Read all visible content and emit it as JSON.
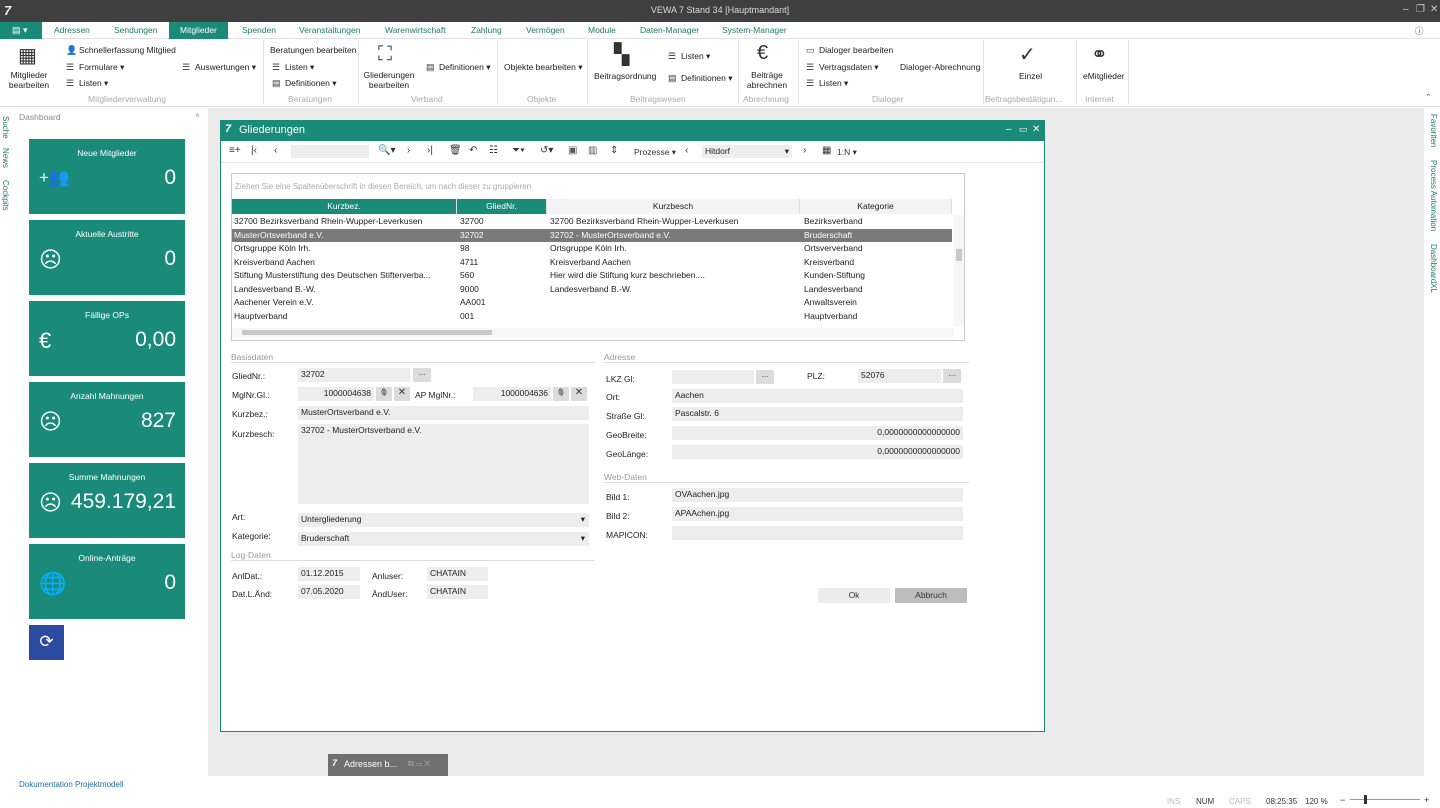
{
  "window": {
    "title": "VEWA 7 Stand 34 [Hauptmandant]",
    "logo": "7"
  },
  "menu": {
    "tabs": [
      "Adressen",
      "Sendungen",
      "Mitglieder",
      "Spenden",
      "Veranstaltungen",
      "Warenwirtschaft",
      "Zahlung",
      "Vermögen",
      "Module",
      "Daten-Manager",
      "System-Manager"
    ],
    "active": "Mitglieder"
  },
  "ribbon": {
    "mitglieder_bearbeiten": "Mitglieder bearbeiten",
    "schnellerfassung": "Schnellerfassung Mitglied",
    "formulare": "Formulare",
    "listen": "Listen",
    "auswertungen": "Auswertungen",
    "beratungen_bearbeiten": "Beratungen bearbeiten",
    "beratungen_listen": "Listen",
    "beratungen_definitionen": "Definitionen",
    "gliederungen_bearbeiten": "Gliederungen bearbeiten",
    "verband_definitionen": "Definitionen",
    "objekte_bearbeiten": "Objekte bearbeiten",
    "beitragsordnung": "Beitragsordnung",
    "bw_listen": "Listen",
    "bw_definitionen": "Definitionen",
    "beitraege_abrechnen": "Beiträge abrechnen",
    "dialoger_bearbeiten": "Dialoger bearbeiten",
    "vertragsdaten": "Vertragsdaten",
    "dialoger_listen": "Listen",
    "dialoger_abrechnung": "Dialoger-Abrechnung",
    "einzel": "Einzel",
    "emitglieder": "eMitglieder",
    "groups": [
      "Mitgliederverwaltung",
      "Beratungen",
      "Verband",
      "Objekte",
      "Beitragswesen",
      "Abrechnung",
      "Dialoger",
      "Beitragsbestätigun...",
      "Internet"
    ]
  },
  "sidenav": [
    "Suche",
    "News",
    "Cockpits"
  ],
  "rightnav": [
    "Favoriten",
    "Process Automation",
    "DashboardXL"
  ],
  "dashboard": {
    "title": "Dashboard",
    "tiles": [
      {
        "label": "Neue Mitglieder",
        "value": "0",
        "icon": "add-people-icon"
      },
      {
        "label": "Aktuelle Austritte",
        "value": "0",
        "icon": "sad-face-icon"
      },
      {
        "label": "Fällige OPs",
        "value": "0,00",
        "icon": "euro-icon"
      },
      {
        "label": "Anzahl Mahnungen",
        "value": "827",
        "icon": "sad-face-icon"
      },
      {
        "label": "Summe Mahnungen",
        "value": "459.179,21",
        "icon": "sad-face-icon"
      },
      {
        "label": "Online-Anträge",
        "value": "0",
        "icon": "globe-icon"
      }
    ]
  },
  "dialog": {
    "title": "Gliederungen",
    "toolbar": {
      "prozesse": "Prozesse",
      "dropdown": "Hitdorf",
      "ratio": "1:N"
    },
    "grid": {
      "group_hint": "Ziehen Sie eine Spaltenüberschrift in diesen Bereich, um nach dieser zu gruppieren",
      "columns": [
        "Kurzbez.",
        "GliedNr.",
        "Kurzbesch",
        "Kategorie"
      ],
      "rows": [
        [
          "32700 Bezirksverband Rhein-Wupper-Leverkusen",
          "32700",
          "32700 Bezirksverband Rhein-Wupper-Leverkusen",
          "Bezirksverband"
        ],
        [
          "MusterOrtsverband e.V.",
          "32702",
          "32702 - MusterOrtsverband e.V.",
          "Bruderschaft"
        ],
        [
          "Ortsgruppe Köln Irh.",
          "98",
          "Ortsgruppe Köln Irh.",
          "Ortsververband"
        ],
        [
          "Kreisverband Aachen",
          "4711",
          "Kreisverband Aachen",
          "Kreisverband"
        ],
        [
          "Stiftung Musterstiftung des Deutschen Stifterverba...",
          "560",
          "Hier wird die Stiftung kurz beschrieben....",
          "Kunden-Stiftung"
        ],
        [
          "Landesverband B.-W.",
          "9000",
          "Landesverband B.-W.",
          "Landesverband"
        ],
        [
          "Aachener Verein e.V.",
          "AA001",
          "",
          "Anwaltsverein"
        ],
        [
          "Hauptverband",
          "001",
          "",
          "Hauptverband"
        ]
      ],
      "selected_index": 1
    },
    "basis": {
      "section": "Basisdaten",
      "gliednr_label": "GliedNr.:",
      "gliednr": "32702",
      "mglnr_label": "MglNr.Gl.:",
      "mglnr": "1000004638",
      "ap_label": "AP MglNr.:",
      "ap": "1000004636",
      "kurzbez_label": "Kurzbez.:",
      "kurzbez": "MusterOrtsverband e.V.",
      "kurzbesch_label": "Kurzbesch:",
      "kurzbesch": "32702 - MusterOrtsverband e.V.",
      "art_label": "Art:",
      "art": "Untergliederung",
      "kategorie_label": "Kategorie:",
      "kategorie": "Bruderschaft"
    },
    "log": {
      "section": "Log-Daten",
      "anldat_label": "AnlDat.:",
      "anldat": "01.12.2015",
      "anluser_label": "Anluser:",
      "anluser": "CHATAIN",
      "datland_label": "Dat.L.Änd:",
      "datland": "07.05.2020",
      "anduser_label": "ÄndUser:",
      "anduser": "CHATAIN"
    },
    "adresse": {
      "section": "Adresse",
      "lkz_label": "LKZ Gl:",
      "lkz": "",
      "plz_label": "PLZ:",
      "plz": "52076",
      "ort_label": "Ort:",
      "ort": "Aachen",
      "strasse_label": "Straße Gl:",
      "strasse": "Pascalstr. 6",
      "geobreite_label": "GeoBreite:",
      "geobreite": "0,0000000000000000",
      "geolaenge_label": "GeoLänge:",
      "geolaenge": "0,0000000000000000"
    },
    "web": {
      "section": "Web-Daten",
      "bild1_label": "Bild 1:",
      "bild1": "OVAachen.jpg",
      "bild2_label": "Bild 2:",
      "bild2": "APAAchen.jpg",
      "mapicon_label": "MAPICON:",
      "mapicon": ""
    },
    "ok": "Ok",
    "abbruch": "Abbruch"
  },
  "taskbar": {
    "item": "Adressen b..."
  },
  "status": {
    "doc_link": "Dokumentation Projektmodell",
    "ins": "INS",
    "num": "NUM",
    "caps": "CAPS",
    "time": "08:25:35",
    "zoom": "120 %"
  }
}
